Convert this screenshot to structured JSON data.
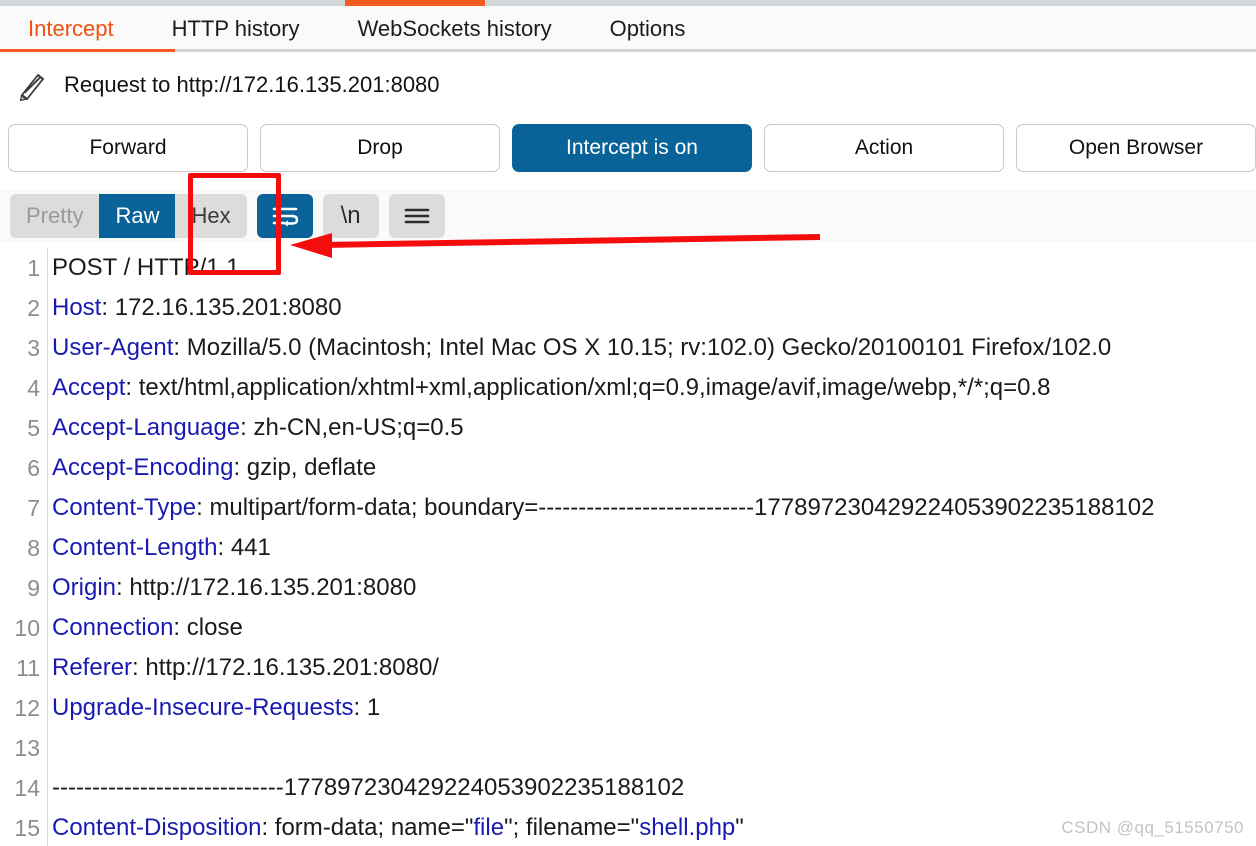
{
  "window": {
    "tabs": [
      {
        "label": "Intercept",
        "active": true
      },
      {
        "label": "HTTP history",
        "active": false
      },
      {
        "label": "WebSockets history",
        "active": false
      },
      {
        "label": "Options",
        "active": false
      }
    ],
    "active_tab_color": "#f2500f",
    "tab_underline_color": "#f25a1e"
  },
  "request_header": {
    "icon": "pencil-icon",
    "title": "Request to http://172.16.135.201:8080"
  },
  "actions": {
    "forward": "Forward",
    "drop": "Drop",
    "intercept_toggle": "Intercept is on",
    "intercept_toggle_color": "#0a6398",
    "action": "Action",
    "open_browser": "Open Browser"
  },
  "editor_toolbar": {
    "view_modes": [
      {
        "label": "Pretty",
        "state": "disabled"
      },
      {
        "label": "Raw",
        "state": "selected"
      },
      {
        "label": "Hex",
        "state": "normal"
      }
    ],
    "selected_mode_color": "#0a6398",
    "icons": [
      {
        "name": "word-wrap-icon",
        "label": "",
        "active": true
      },
      {
        "name": "newline-icon",
        "label": "\\n",
        "active": false
      },
      {
        "name": "hamburger-menu-icon",
        "label": "",
        "active": false
      }
    ]
  },
  "request_body": {
    "header_name_color": "#1a1ab0",
    "lines": [
      {
        "n": "1",
        "type": "plain",
        "text": "POST / HTTP/1.1"
      },
      {
        "n": "2",
        "type": "header",
        "name": "Host",
        "value": "172.16.135.201:8080"
      },
      {
        "n": "3",
        "type": "header",
        "name": "User-Agent",
        "value": "Mozilla/5.0 (Macintosh; Intel Mac OS X 10.15; rv:102.0) Gecko/20100101 Firefox/102.0"
      },
      {
        "n": "4",
        "type": "header",
        "name": "Accept",
        "value": "text/html,application/xhtml+xml,application/xml;q=0.9,image/avif,image/webp,*/*;q=0.8"
      },
      {
        "n": "5",
        "type": "header",
        "name": "Accept-Language",
        "value": "zh-CN,en-US;q=0.5"
      },
      {
        "n": "6",
        "type": "header",
        "name": "Accept-Encoding",
        "value": "gzip, deflate"
      },
      {
        "n": "7",
        "type": "header",
        "name": "Content-Type",
        "value": "multipart/form-data; boundary=---------------------------177897230429224053902235188102"
      },
      {
        "n": "8",
        "type": "header",
        "name": "Content-Length",
        "value": "441"
      },
      {
        "n": "9",
        "type": "header",
        "name": "Origin",
        "value": "http://172.16.135.201:8080"
      },
      {
        "n": "10",
        "type": "header",
        "name": "Connection",
        "value": "close"
      },
      {
        "n": "11",
        "type": "header",
        "name": "Referer",
        "value": "http://172.16.135.201:8080/"
      },
      {
        "n": "12",
        "type": "header",
        "name": "Upgrade-Insecure-Requests",
        "value": "1"
      },
      {
        "n": "13",
        "type": "plain",
        "text": ""
      },
      {
        "n": "14",
        "type": "plain",
        "text": "-----------------------------177897230429224053902235188102"
      },
      {
        "n": "15",
        "type": "disposition",
        "name": "Content-Disposition",
        "pre": " form-data; name=\"",
        "str1": "file",
        "mid": "\"; filename=\"",
        "str2": "shell.php",
        "post": "\""
      }
    ]
  },
  "annotations": {
    "highlight_box": {
      "target": "Hex",
      "color": "#f50d0d"
    },
    "arrow": {
      "direction": "left",
      "color": "#f50d0d",
      "points_to": "Hex"
    }
  },
  "watermark": {
    "text": "CSDN @qq_51550750"
  }
}
